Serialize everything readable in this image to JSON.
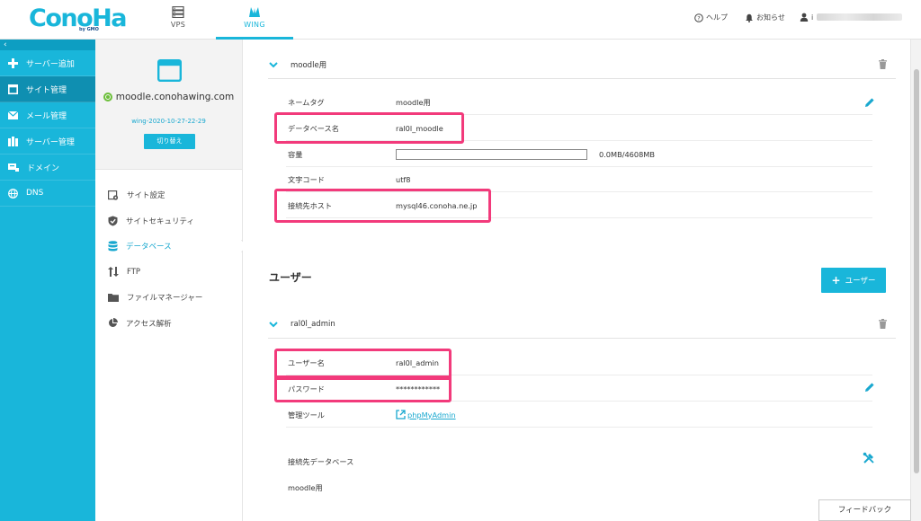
{
  "header": {
    "logo": "ConoHa",
    "logo_sub": "by GMO",
    "tabs": [
      {
        "label": "VPS",
        "icon": "server-icon"
      },
      {
        "label": "WING",
        "icon": "wing-icon",
        "active": true
      }
    ],
    "help_label": "ヘルプ",
    "notice_label": "お知らせ",
    "user_label": "i"
  },
  "sidebar": {
    "collapse_label": "‹",
    "items": [
      {
        "label": "サーバー追加",
        "icon": "plus-icon"
      },
      {
        "label": "サイト管理",
        "icon": "window-icon",
        "active": true
      },
      {
        "label": "メール管理",
        "icon": "mail-icon"
      },
      {
        "label": "サーバー管理",
        "icon": "server-icon"
      },
      {
        "label": "ドメイン",
        "icon": "domain-icon"
      },
      {
        "label": "DNS",
        "icon": "globe-icon"
      }
    ]
  },
  "site": {
    "name": "moodle.conohawing.com",
    "id": "wing-2020-10-27-22-29",
    "switch_label": "切り替え"
  },
  "menu": {
    "items": [
      {
        "label": "サイト設定",
        "icon": "settings-icon"
      },
      {
        "label": "サイトセキュリティ",
        "icon": "shield-icon"
      },
      {
        "label": "データベース",
        "icon": "database-icon",
        "active": true
      },
      {
        "label": "FTP",
        "icon": "transfer-icon"
      },
      {
        "label": "ファイルマネージャー",
        "icon": "folder-icon"
      },
      {
        "label": "アクセス解析",
        "icon": "pie-chart-icon"
      }
    ]
  },
  "database": {
    "title": "moodle用",
    "rows": {
      "name_tag": {
        "label": "ネームタグ",
        "value": "moodle用"
      },
      "db_name": {
        "label": "データベース名",
        "value": "ral0l_moodle"
      },
      "capacity": {
        "label": "容量",
        "value": "0.0MB/4608MB",
        "fraction": 0.0
      },
      "charset": {
        "label": "文字コード",
        "value": "utf8"
      },
      "host": {
        "label": "接続先ホスト",
        "value": "mysql46.conoha.ne.jp"
      }
    }
  },
  "users": {
    "section_title": "ユーザー",
    "add_label": "ユーザー",
    "user": {
      "title": "ral0l_admin",
      "rows": {
        "username": {
          "label": "ユーザー名",
          "value": "ral0l_admin"
        },
        "password": {
          "label": "パスワード",
          "value": "************"
        },
        "tool": {
          "label": "管理ツール",
          "value": "phpMyAdmin"
        }
      },
      "connected_db_label": "接続先データベース",
      "connected_db_value": "moodle用"
    }
  },
  "feedback_label": "フィードバック",
  "colors": {
    "accent": "#19b6da",
    "highlight": "#f23a7b",
    "status": "#6cbf3a"
  }
}
